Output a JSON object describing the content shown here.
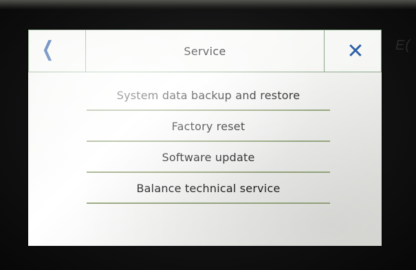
{
  "header": {
    "title": "Service",
    "back_icon": "chevron-left-icon",
    "close_icon": "close-icon",
    "accent_color": "#2f5fa8"
  },
  "menu": {
    "items": [
      {
        "label": "System data backup and restore"
      },
      {
        "label": "Factory reset"
      },
      {
        "label": "Software update"
      },
      {
        "label": "Balance technical service"
      }
    ]
  },
  "bezel": {
    "logo_text": "E("
  }
}
